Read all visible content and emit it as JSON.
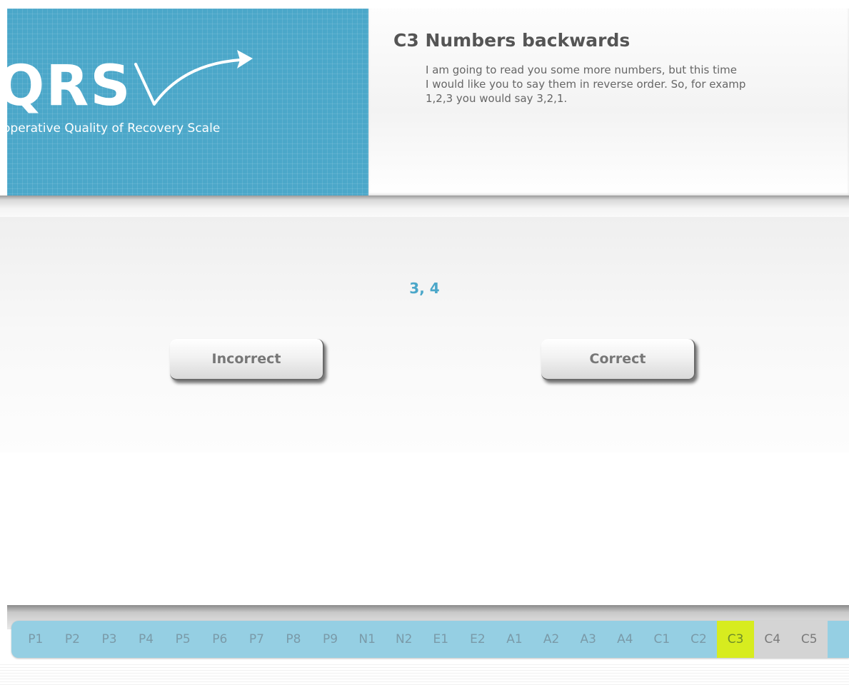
{
  "logo": {
    "text": "QRS",
    "tagline": "operative Quality of Recovery Scale"
  },
  "instruction": {
    "title": "C3 Numbers backwards",
    "body_lines": [
      "I am going to read you some more numbers, but this time",
      "I would like you to say them in reverse order. So, for examp",
      "1,2,3 you would say 3,2,1."
    ]
  },
  "test": {
    "sequence": "3, 4",
    "incorrect_label": "Incorrect",
    "correct_label": "Correct"
  },
  "nav": {
    "items": [
      "P1",
      "P2",
      "P3",
      "P4",
      "P5",
      "P6",
      "P7",
      "P8",
      "P9",
      "N1",
      "N2",
      "E1",
      "E2",
      "A1",
      "A2",
      "A3",
      "A4",
      "C1",
      "C2",
      "C3",
      "C4",
      "C5"
    ],
    "active": "C3"
  },
  "colors": {
    "brand_blue": "#4ba7c9",
    "nav_blue": "#95cfe3",
    "active_highlight": "#d7ec1f",
    "upcoming_grey": "#d4d4d4"
  }
}
